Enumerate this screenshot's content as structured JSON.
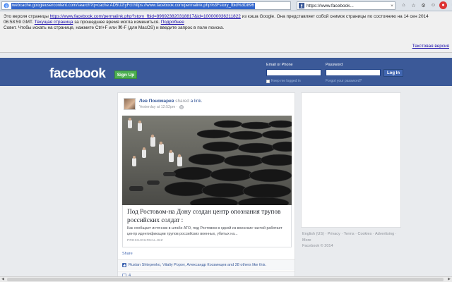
{
  "browser": {
    "url": "webcache.googleusercontent.com/search?q=cache:AD5U2IyFcl:https://www.facebook.com/permalink.php%3Fstory_fbid%3D896",
    "tab_title": "https://www.facebook..."
  },
  "cache_banner": {
    "line1_prefix": "Это версия страницы",
    "line1_link": "https://www.facebook.com/permalink.php?story_fbid=896923820318817&id=100000036211822",
    "line1_suffix": "из кэша Google. Она представляет собой снимок страницы по состоянию на 14 сен 2014",
    "line2_prefix": "06:58:59 GMT.",
    "line2_link": "Текущая страница",
    "line2_mid": "за прошедшее время могла измениться.",
    "line2_link2": "Подробнее",
    "line3": "Совет. Чтобы искать на странице, нажмите Ctrl+F или ⌘-F (для MacOS) и введите запрос в поле поиска.",
    "text_version": "Текстовая версия"
  },
  "header": {
    "logo": "facebook",
    "signup": "Sign Up",
    "email_label": "Email or Phone",
    "password_label": "Password",
    "keep_logged": "Keep me logged in",
    "forgot": "Forgot your password?",
    "login": "Log In"
  },
  "post": {
    "author": "Лев Пономарев",
    "shared": "shared",
    "link_word": "a link.",
    "time": "Yesterday at 12:52pm ·",
    "link_title": "Под Ростовом-на Дону создан центр опознания трупов российских солдат :",
    "link_desc": "Как сообщает источник в штабе АТО, под Ростовом в одной из военских частей работает центр идентификации трупов российских военных, убитых на...",
    "link_source": "PRESSJOURNAL.BIZ",
    "share": "Share",
    "likes": "Ruslan Shtepenko, Vitaliy Popov, Александр Косвинцев and 28 others like this.",
    "comments": "4"
  },
  "sidebar": {
    "footer_links": [
      "English (US)",
      "Privacy",
      "Terms",
      "Cookies",
      "Advertising",
      "More"
    ],
    "copyright": "Facebook © 2014"
  },
  "colors": {
    "facebook_blue": "#3b5998",
    "signup_green": "#4caf50",
    "link_blue": "#365899"
  }
}
